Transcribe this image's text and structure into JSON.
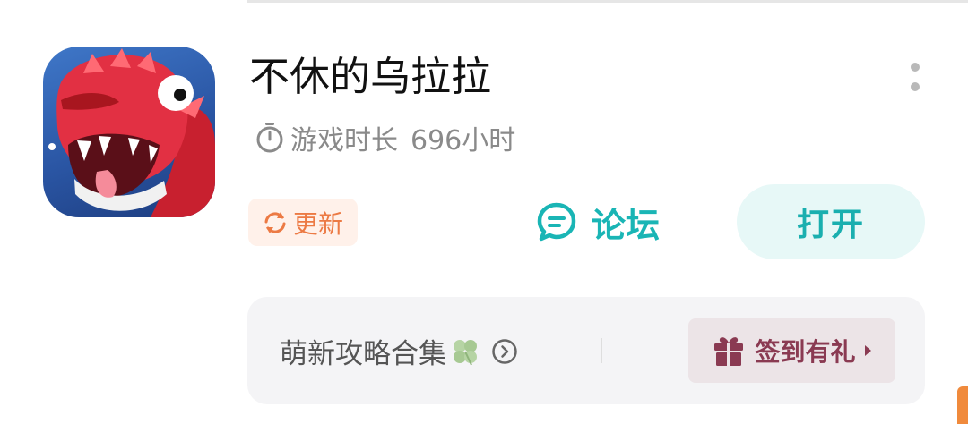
{
  "app": {
    "title": "不休的乌拉拉",
    "playtime_label": "游戏时长",
    "playtime_value": "696小时",
    "icon_name": "dragon-game-icon"
  },
  "actions": {
    "update_label": "更新",
    "forum_label": "论坛",
    "open_label": "打开"
  },
  "panel": {
    "guide_label": "萌新攻略合集",
    "signin_label": "签到有礼"
  },
  "colors": {
    "accent_teal": "#1ab5b5",
    "update_orange": "#ec7a44",
    "signin_maroon": "#8a3a52"
  }
}
